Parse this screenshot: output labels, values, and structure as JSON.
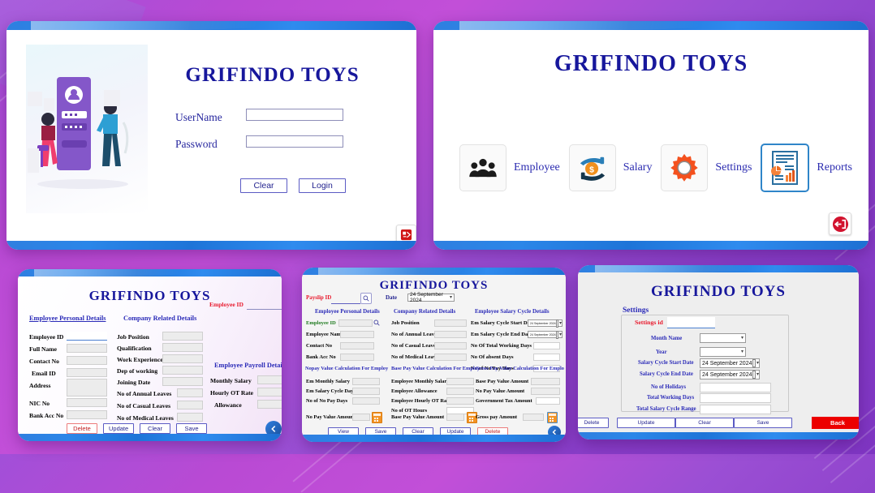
{
  "app": {
    "brand": "GRIFINDO TOYS"
  },
  "login": {
    "title": "GRIFINDO TOYS",
    "username_label": "UserName",
    "username_value": "",
    "password_label": "Password",
    "password_value": "",
    "clear_label": "Clear",
    "login_label": "Login",
    "exit_icon": "exit-logout-icon"
  },
  "menu": {
    "title": "GRIFINDO TOYS",
    "items": [
      {
        "label": "Employee",
        "icon": "people-group-icon",
        "selected": false
      },
      {
        "label": "Salary",
        "icon": "hand-money-icon",
        "selected": false
      },
      {
        "label": "Settings",
        "icon": "gear-icon",
        "selected": false
      },
      {
        "label": "Reports",
        "icon": "report-chart-icon",
        "selected": true
      }
    ],
    "logout_icon": "logout-circle-icon"
  },
  "employee": {
    "title": "GRIFINDO TOYS",
    "search": {
      "label": "Employee ID",
      "value": "",
      "icon": "search-icon"
    },
    "sections": {
      "personal": "Employee Personal Details",
      "company": "Company Related Details",
      "payroll": "Employee Payroll Details"
    },
    "personal_fields": [
      {
        "label": "Employee ID",
        "value": ""
      },
      {
        "label": "Full Name",
        "value": ""
      },
      {
        "label": "Contact No",
        "value": ""
      },
      {
        "label": "Email ID",
        "value": ""
      },
      {
        "label": "Address",
        "value": ""
      },
      {
        "label": "NIC No",
        "value": ""
      },
      {
        "label": "Bank Acc No",
        "value": ""
      }
    ],
    "company_fields": [
      {
        "label": "Job Position",
        "value": ""
      },
      {
        "label": "Qualification",
        "value": ""
      },
      {
        "label": "Work Experience",
        "value": ""
      },
      {
        "label": "Dep of working",
        "value": ""
      },
      {
        "label": "Joining Date",
        "value": ""
      },
      {
        "label": "No of Annual Leaves",
        "value": ""
      },
      {
        "label": "No of Casual Leaves",
        "value": ""
      },
      {
        "label": "No of Medical Leaves",
        "value": ""
      }
    ],
    "payroll_fields": [
      {
        "label": "Monthly Salary",
        "value": ""
      },
      {
        "label": "Hourly OT Rate",
        "value": ""
      },
      {
        "label": "Allowance",
        "value": ""
      }
    ],
    "buttons": [
      {
        "label": "Delete",
        "style": "red"
      },
      {
        "label": "Update",
        "style": "blue"
      },
      {
        "label": "Clear",
        "style": "blue"
      },
      {
        "label": "Save",
        "style": "blue"
      }
    ],
    "back_icon": "back-arrow-circle-icon"
  },
  "payroll": {
    "title": "GRIFINDO TOYS",
    "payslip_label": "Payslip ID",
    "payslip_value": "",
    "payslip_search_icon": "search-icon",
    "date_label": "Date",
    "date_value": "24 September 2024",
    "sections": {
      "personal": "Employee Personal Details",
      "company": "Company Related Details",
      "cycle": "Employee Salary Cycle Details",
      "nopay": "Nopay Value Calculation For Employ",
      "basepay": "Base Pay Value Calculation For Employ",
      "grosspay": "Gross Pay Value Calculation For Emplo"
    },
    "personal_fields": [
      {
        "label": "Employee ID",
        "value": "",
        "icon": "search-icon"
      },
      {
        "label": "Employee Name",
        "value": ""
      },
      {
        "label": "Contact No",
        "value": ""
      },
      {
        "label": "Bank Acc No",
        "value": ""
      }
    ],
    "company_fields": [
      {
        "label": "Job Position",
        "value": ""
      },
      {
        "label": "No of Annual Leaves",
        "value": ""
      },
      {
        "label": "No of Casual Leaves",
        "value": ""
      },
      {
        "label": "No of Medical Leaves",
        "value": ""
      }
    ],
    "cycle_fields": [
      {
        "label": "Em Salary Cycle Start Date",
        "value": "24 September 2024",
        "type": "date"
      },
      {
        "label": "Em  Salary Cycle End Date",
        "value": "24 September 2024",
        "type": "date"
      },
      {
        "label": "No Of Total Working Days",
        "value": "",
        "type": "text"
      },
      {
        "label": "No Of absent Days",
        "value": "",
        "type": "text"
      },
      {
        "label": "No of No Pay Days",
        "value": "",
        "type": "text"
      }
    ],
    "nopay_fields": [
      {
        "label": "Em Monthly Salary",
        "value": ""
      },
      {
        "label": "Em Salary Cycle Days",
        "value": ""
      },
      {
        "label": "No of No Pay Days",
        "value": ""
      }
    ],
    "basepay_fields": [
      {
        "label": "Employee Monthly Salary",
        "value": ""
      },
      {
        "label": "Employee Allowance",
        "value": ""
      },
      {
        "label": "Employee Hourly OT Rate",
        "value": ""
      },
      {
        "label": "No of OT Hours",
        "value": ""
      }
    ],
    "grosspay_fields": [
      {
        "label": "Base Pay Value Amount",
        "value": ""
      },
      {
        "label": "No Pay Value Amount",
        "value": ""
      },
      {
        "label": "Government Tax Amount",
        "value": ""
      }
    ],
    "results": [
      {
        "label": "No Pay Value Amount",
        "value": "",
        "icon": "calculator-icon"
      },
      {
        "label": "Base Pay Value Amount",
        "value": "",
        "icon": "calculator-icon"
      },
      {
        "label": "Gross pay Amount",
        "value": "",
        "icon": "calculator-icon"
      }
    ],
    "buttons": [
      {
        "label": "View",
        "style": "blue"
      },
      {
        "label": "Save",
        "style": "blue"
      },
      {
        "label": "Clear",
        "style": "blue"
      },
      {
        "label": "Update",
        "style": "blue"
      },
      {
        "label": "Delete",
        "style": "red"
      }
    ],
    "back_icon": "back-arrow-circle-icon"
  },
  "settings": {
    "title": "GRIFINDO TOYS",
    "group_label": "Settings",
    "settings_id_label": "Settings id",
    "settings_id_value": "",
    "fields": [
      {
        "label": "Month Name",
        "value": "",
        "type": "combo"
      },
      {
        "label": "Year",
        "value": "",
        "type": "combo"
      },
      {
        "label": "Salary Cycle Start Date",
        "value": "24 September 2024",
        "type": "date"
      },
      {
        "label": "Salary Cycle End Date",
        "value": "24 September 2024",
        "type": "date"
      },
      {
        "label": "No of Holidays",
        "value": "",
        "type": "text"
      },
      {
        "label": "Total Working Days",
        "value": "",
        "type": "text"
      },
      {
        "label": "Total Salary Cycle Range",
        "value": "",
        "type": "text"
      }
    ],
    "buttons": [
      {
        "label": "Delete",
        "style": "blue"
      },
      {
        "label": "Update",
        "style": "blue"
      },
      {
        "label": "Clear",
        "style": "blue"
      },
      {
        "label": "Save",
        "style": "blue"
      }
    ],
    "back_label": "Back"
  },
  "colors": {
    "brand_blue": "#17179c",
    "accent_blue": "#2b2bb8",
    "danger_red": "#e00000",
    "label_red": "#e8192c",
    "label_green": "#1d7a1d",
    "bar_blue": "#2b86e8",
    "orange": "#f39324"
  }
}
